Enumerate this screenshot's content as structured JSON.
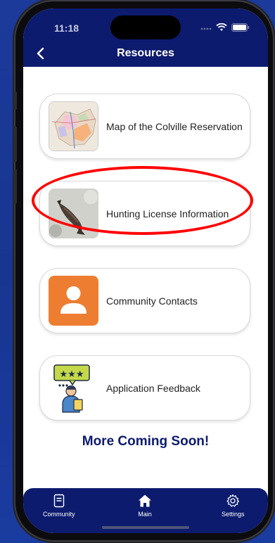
{
  "status_bar": {
    "time": "11:18"
  },
  "header": {
    "title": "Resources"
  },
  "resources": [
    {
      "label": "Map of the Colville Reservation",
      "thumb": "map-thumbnail"
    },
    {
      "label": "Hunting License Information",
      "thumb": "fish-photo-thumbnail"
    },
    {
      "label": "Community Contacts",
      "thumb": "person-icon"
    },
    {
      "label": "Application Feedback",
      "thumb": "feedback-icon"
    }
  ],
  "footer_note": "More Coming Soon!",
  "tabs": [
    {
      "label": "Community",
      "icon": "document-icon"
    },
    {
      "label": "Main",
      "icon": "home-icon"
    },
    {
      "label": "Settings",
      "icon": "gear-icon"
    }
  ],
  "colors": {
    "header": "#0d1b6e",
    "accent_orange": "#ed7d31",
    "annotation": "#ff0000",
    "background": "#183591"
  }
}
